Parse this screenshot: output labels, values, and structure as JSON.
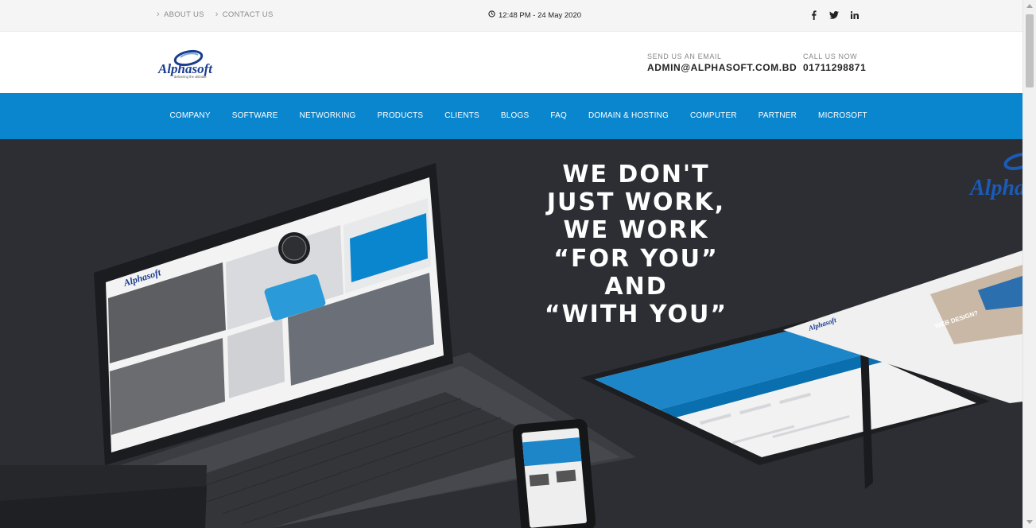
{
  "topbar": {
    "links": [
      "ABOUT US",
      "CONTACT US"
    ],
    "datetime": "12:48 PM - 24 May 2020",
    "social": [
      "facebook-icon",
      "twitter-icon",
      "linkedin-icon"
    ]
  },
  "header": {
    "logo_text": "Alphasoft",
    "logo_tagline": "delivering the ultimate",
    "email_label": "SEND US AN EMAIL",
    "email_value": "ADMIN@ALPHASOFT.COM.BD",
    "phone_label": "CALL US NOW",
    "phone_value": "01711298871"
  },
  "nav": {
    "items": [
      "COMPANY",
      "SOFTWARE",
      "NETWORKING",
      "PRODUCTS",
      "CLIENTS",
      "BLOGS",
      "FAQ",
      "DOMAIN & HOSTING",
      "COMPUTER",
      "PARTNER",
      "MICROSOFT"
    ]
  },
  "hero": {
    "slogan_lines": [
      "WE DON'T",
      "JUST WORK,",
      "WE WORK",
      "“FOR YOU”",
      "AND",
      "“WITH YOU”"
    ],
    "screen_logo": "Alphasoft",
    "tablet_banner": "WEB DESIGN?"
  },
  "colors": {
    "brand_blue": "#0a86cf",
    "hero_bg": "#2c2e33",
    "topbar_bg": "#f5f5f5"
  }
}
